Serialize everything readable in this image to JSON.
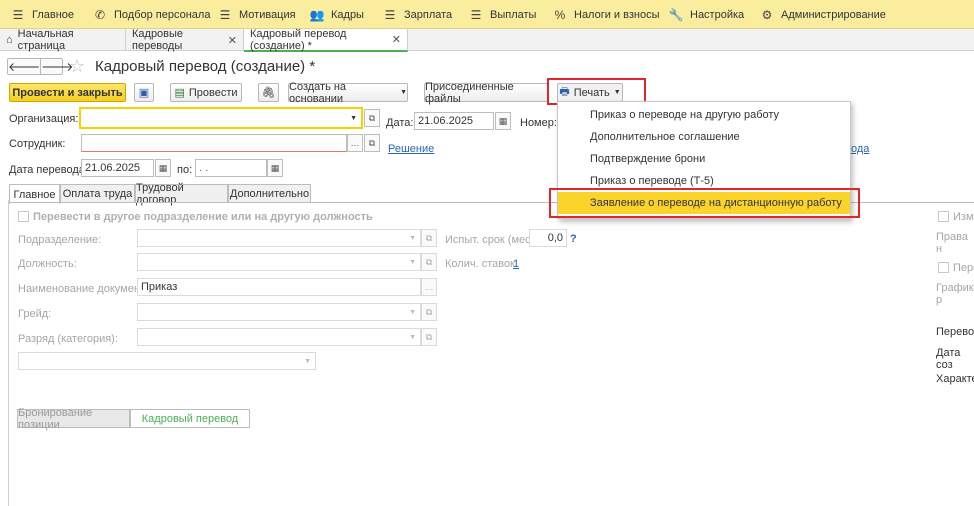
{
  "menu": {
    "items": [
      {
        "label": "Главное",
        "icon": "grid-icon"
      },
      {
        "label": "Подбор персонала",
        "icon": "phone-icon"
      },
      {
        "label": "Мотивация",
        "icon": "grid-icon"
      },
      {
        "label": "Кадры",
        "icon": "users-icon"
      },
      {
        "label": "Зарплата",
        "icon": "grid-icon"
      },
      {
        "label": "Выплаты",
        "icon": "grid-icon"
      },
      {
        "label": "Налоги и взносы",
        "icon": "percent-icon"
      },
      {
        "label": "Настройка",
        "icon": "wrench-icon"
      },
      {
        "label": "Администрирование",
        "icon": "gear-icon"
      }
    ]
  },
  "tabs": {
    "home": "Начальная страница",
    "transfers": "Кадровые переводы",
    "current": "Кадровый перевод (создание) *"
  },
  "header": {
    "title": "Кадровый перевод (создание) *"
  },
  "toolbar": {
    "post_close": "Провести и закрыть",
    "post": "Провести",
    "create_based": "Создать на основании",
    "attached": "Присоединенные файлы",
    "print": "Печать"
  },
  "print_menu": {
    "items": [
      "Приказ о переводе на другую работу",
      "Дополнительное соглашение",
      "Подтверждение брони",
      "Приказ о переводе (Т-5)",
      "Заявление о переводе на дистанционную работу"
    ],
    "selected_index": 4
  },
  "form": {
    "org_label": "Организация:",
    "date_label": "Дата:",
    "date_value": "21.06.2025",
    "number_label": "Номер:",
    "employee_label": "Сотрудник:",
    "decision_link": "Решение",
    "partial_link": "ода",
    "transfer_date_label": "Дата перевода:",
    "transfer_date_value": "21.06.2025",
    "to_label": "по:",
    "to_value": " .  ."
  },
  "section_tabs": [
    "Главное",
    "Оплата труда",
    "Трудовой договор",
    "Дополнительно"
  ],
  "main_tab": {
    "move_check": "Перевести в другое подразделение или на другую должность",
    "department_label": "Подразделение:",
    "position_label": "Должность:",
    "doc_name_label": "Наименование документа:",
    "doc_name_value": "Приказ",
    "grade_label": "Грейд:",
    "rank_label": "Разряд (категория):",
    "probation_label": "Испыт. срок (мес):",
    "probation_value": "0,0",
    "help": "?",
    "rates_label": "Колич. ставок:",
    "rates_value": "1",
    "booking_btn": "Бронирование позиции",
    "transfer_btn": "Кадровый перевод"
  },
  "right_partial": {
    "izm": "Изм",
    "prava": "Права н",
    "pere": "Пере",
    "grafik": "График р",
    "perevod": "Перевод",
    "data_soz": "Дата соз",
    "harakter": "Характер"
  }
}
